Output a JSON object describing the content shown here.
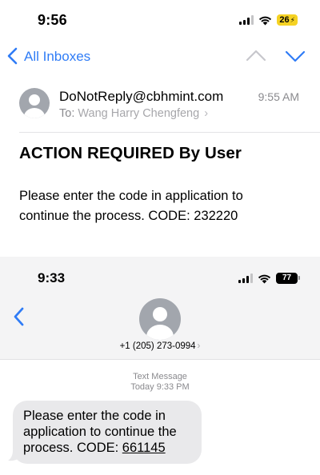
{
  "mail": {
    "status": {
      "time": "9:56",
      "battery": "26"
    },
    "nav": {
      "back_label": "All Inboxes"
    },
    "message": {
      "sender": "DoNotReply@cbhmint.com",
      "time": "9:55 AM",
      "to_prefix": "To:",
      "to_name": "Wang Harry Chengfeng",
      "subject": "ACTION REQUIRED By User",
      "body": "Please enter the code in application to continue the process. CODE: 232220"
    }
  },
  "messages": {
    "status": {
      "time": "9:33",
      "battery": "77"
    },
    "contact": {
      "number": "+1 (205) 273-0994"
    },
    "thread": {
      "type_label": "Text Message",
      "timestamp": "Today 9:33 PM",
      "bubble_text": "Please enter the code in application to continue the process. CODE: ",
      "bubble_code": "661145"
    }
  },
  "colors": {
    "accent": "#2f7cf6",
    "bubble": "#e9e9eb",
    "meta": "#8a8a8e"
  },
  "icons": [
    "signal-icon",
    "wifi-icon",
    "battery-icon",
    "chevron-left-icon",
    "chevron-up-icon",
    "chevron-down-icon",
    "avatar-icon",
    "chevron-right-icon"
  ]
}
